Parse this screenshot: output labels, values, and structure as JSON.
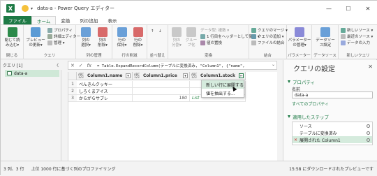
{
  "window": {
    "title": "data-a - Power Query エディター",
    "app_icon": "X",
    "minimize": "—",
    "maximize": "☐",
    "close": "✕"
  },
  "tabs": [
    "ファイル",
    "ホーム",
    "変換",
    "列の追加",
    "表示"
  ],
  "ribbon": {
    "close_group": {
      "button": "閉じて読\nみ込む▾",
      "label": "閉じる"
    },
    "query_group": {
      "preview": "プレビュー\nの更新▾",
      "properties": "プロパティ",
      "advanced_editor": "詳細エディター",
      "manage": "管理 ▾",
      "label": "クエリ"
    },
    "columns_group": {
      "select": "列の\n選択▾",
      "remove": "列の\n削除▾",
      "label": "列の管理"
    },
    "rows_group": {
      "keep": "行の\n保持▾",
      "remove": "行の\n削除▾",
      "label": "行の削減"
    },
    "sort_group": {
      "label": "並べ替え"
    },
    "transform_group": {
      "split": "列の\n分割▾",
      "group": "グルー\nプ化",
      "datatype": "データ型: 複数 ▾",
      "first_row": "1 行目をヘッダーとして使用 ▾",
      "replace": "値の置換",
      "label": "変換"
    },
    "combine_group": {
      "merge": "クエリのマージ ▾",
      "append": "クエリの追加 ▾",
      "combine_files": "ファイルの結合",
      "label": "結合"
    },
    "params_group": {
      "button": "パラメーター\nの管理▾",
      "label": "パラメーター"
    },
    "datasource_group": {
      "button": "データソー\nス設定",
      "label": "データソース"
    },
    "newquery_group": {
      "new_source": "新しいソース ▾",
      "recent": "最近のソース ▾",
      "enter_data": "データの入力",
      "label": "新しいクエリ"
    }
  },
  "left_pane": {
    "header": "クエリ [1]",
    "collapse": "〈",
    "items": [
      "data-a"
    ]
  },
  "formula_bar": {
    "cancel": "✕",
    "commit": "✓",
    "fx": "fx",
    "text": "= Table.ExpandRecordColumn(テーブルに変換済み, \"Column1\", {\"name\",",
    "expand": "⌄"
  },
  "grid": {
    "columns": [
      {
        "type": "ABC\n123",
        "name": "Column1.name"
      },
      {
        "type": "ABC\n123",
        "name": "Column1.price"
      },
      {
        "type": "ABC\n123",
        "name": "Column1.stock"
      }
    ],
    "rows": [
      {
        "num": "1",
        "name": "べんきんクッキー",
        "price": "",
        "stock": ""
      },
      {
        "num": "2",
        "name": "しろくまアイス",
        "price": "",
        "stock": ""
      },
      {
        "num": "3",
        "name": "からがらサブレ",
        "price": "180",
        "stock": "List"
      }
    ]
  },
  "context_menu": {
    "items": [
      "新しい行に展開する",
      "値を抽出する..."
    ]
  },
  "right_pane": {
    "title": "クエリの設定",
    "close": "✕",
    "properties_header": "プロパティ",
    "name_label": "名前",
    "name_value": "data-a",
    "all_properties": "すべてのプロパティ",
    "steps_header": "適用したステップ",
    "steps": [
      "ソース",
      "テーブルに変換済み",
      "展開された Column1"
    ]
  },
  "status": {
    "left": "3 列、3 行",
    "middle": "上位 1000 行に基づく列のプロファイリング",
    "right": "15:58 にダウンロードされたプレビューです"
  },
  "colors": {
    "accent": "#1d7a45",
    "selection": "#d5ebdd",
    "list_link": "#2c8a4a"
  }
}
